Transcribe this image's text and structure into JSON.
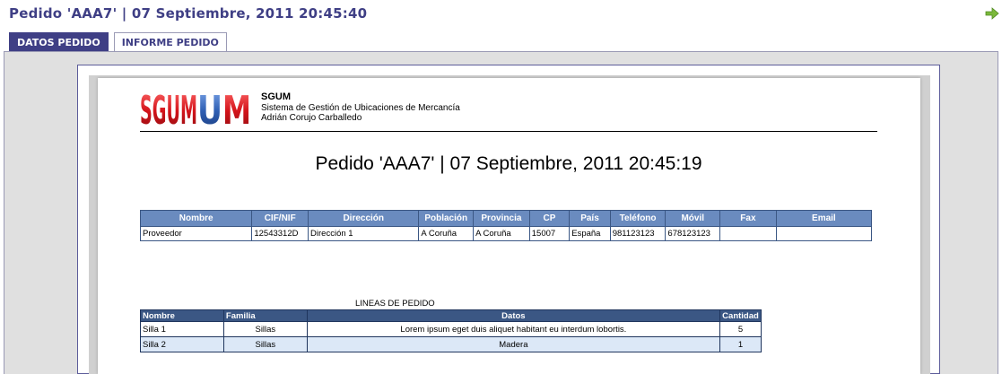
{
  "header": {
    "title": "Pedido 'AAA7' | 07 Septiembre, 2011 20:45:40",
    "next_icon": "arrow-right-icon"
  },
  "tabs": [
    {
      "label": "DATOS PEDIDO",
      "active": true
    },
    {
      "label": "INFORME PEDIDO",
      "active": false
    }
  ],
  "report": {
    "logo_text": "SGUM",
    "company_name": "SGUM",
    "company_desc": "Sistema de Gestión de Ubicaciones de Mercancía",
    "company_author": "Adrián Corujo Carballedo",
    "title": "Pedido 'AAA7' | 07 Septiembre, 2011 20:45:19",
    "supplier_table": {
      "headers": [
        "Nombre",
        "CIF/NIF",
        "Dirección",
        "Población",
        "Provincia",
        "CP",
        "País",
        "Teléfono",
        "Móvil",
        "Fax",
        "Email"
      ],
      "row": [
        "Proveedor",
        "12543312D",
        "Dirección 1",
        "A Coruña",
        "A Coruña",
        "15007",
        "España",
        "981123123",
        "678123123",
        "",
        ""
      ]
    },
    "lines_caption": "LINEAS DE PEDIDO",
    "lines_table": {
      "headers": [
        "Nombre",
        "Familia",
        "Datos",
        "Cantidad"
      ],
      "rows": [
        [
          "Silla 1",
          "Sillas",
          "Lorem ipsum eget duis aliquet habitant eu interdum lobortis.",
          "5"
        ],
        [
          "Silla 2",
          "Sillas",
          "Madera",
          "1"
        ]
      ]
    }
  },
  "colors": {
    "title": "#3f3f85",
    "tab_active_bg": "#3f3f85",
    "table_header": "#6a8bbf",
    "lines_header": "#3b5784",
    "logo_red": "#d4141b",
    "logo_blue": "#2f5fb4",
    "next_arrow": "#7bb83a"
  }
}
